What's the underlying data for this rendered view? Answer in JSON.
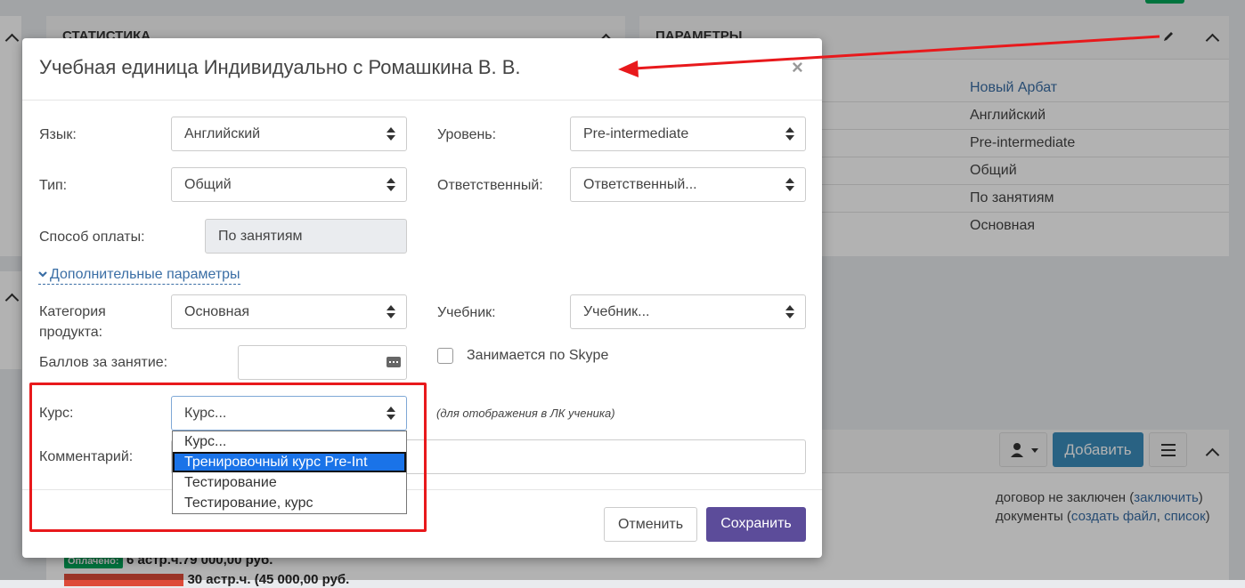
{
  "background": {
    "stats_title": "СТАТИСТИКА",
    "params_title": "ПАРАМЕТРЫ",
    "params_values": [
      "Новый Арбат",
      "Английский",
      "Pre-intermediate",
      "Общий",
      "По занятиям",
      "Основная"
    ],
    "add_label": "Добавить",
    "contract_prefix": "договор не заключен (",
    "contract_link": "заключить",
    "contract_suffix": ")",
    "docs_prefix": "документы (",
    "docs_link1": "создать файл",
    "docs_sep": ", ",
    "docs_link2": "список",
    "docs_suffix": ")",
    "paid_badge": "Оплачено:",
    "paid_text": "6 астр.ч.",
    "paid_amount": "79 000,00 руб.",
    "unpaid_text": "30 астр.ч. (45 000,00 руб."
  },
  "modal": {
    "title": "Учебная единица Индивидуально с Ромашкина В. В.",
    "close": "×",
    "language": {
      "label": "Язык:",
      "value": "Английский"
    },
    "level": {
      "label": "Уровень:",
      "value": "Pre-intermediate"
    },
    "type": {
      "label": "Тип:",
      "value": "Общий"
    },
    "responsible": {
      "label": "Ответственный:",
      "value": "Ответственный..."
    },
    "payment": {
      "label": "Способ оплаты:",
      "value": "По занятиям"
    },
    "extra_params": "Дополнительные параметры",
    "category": {
      "label_line1": "Категория",
      "label_line2": "продукта:",
      "value": "Основная"
    },
    "textbook": {
      "label": "Учебник:",
      "value": "Учебник..."
    },
    "points": {
      "label": "Баллов за занятие:",
      "value": ""
    },
    "skype": {
      "label": "Занимается по Skype"
    },
    "course": {
      "label": "Курс:",
      "value": "Курс...",
      "hint": "(для отображения в ЛК ученика)",
      "options": [
        "Курс...",
        "Тренировочный курс Pre-Int",
        "Тестирование",
        "Тестирование, курс"
      ],
      "highlighted_index": 1
    },
    "comment": {
      "label": "Комментарий:",
      "value": ""
    },
    "cancel": "Отменить",
    "save": "Сохранить"
  },
  "colors": {
    "primary": "#5c4c9a",
    "add_button": "#3c8dbc",
    "annotation_red": "#e8191c",
    "link": "#3a6ea5"
  }
}
